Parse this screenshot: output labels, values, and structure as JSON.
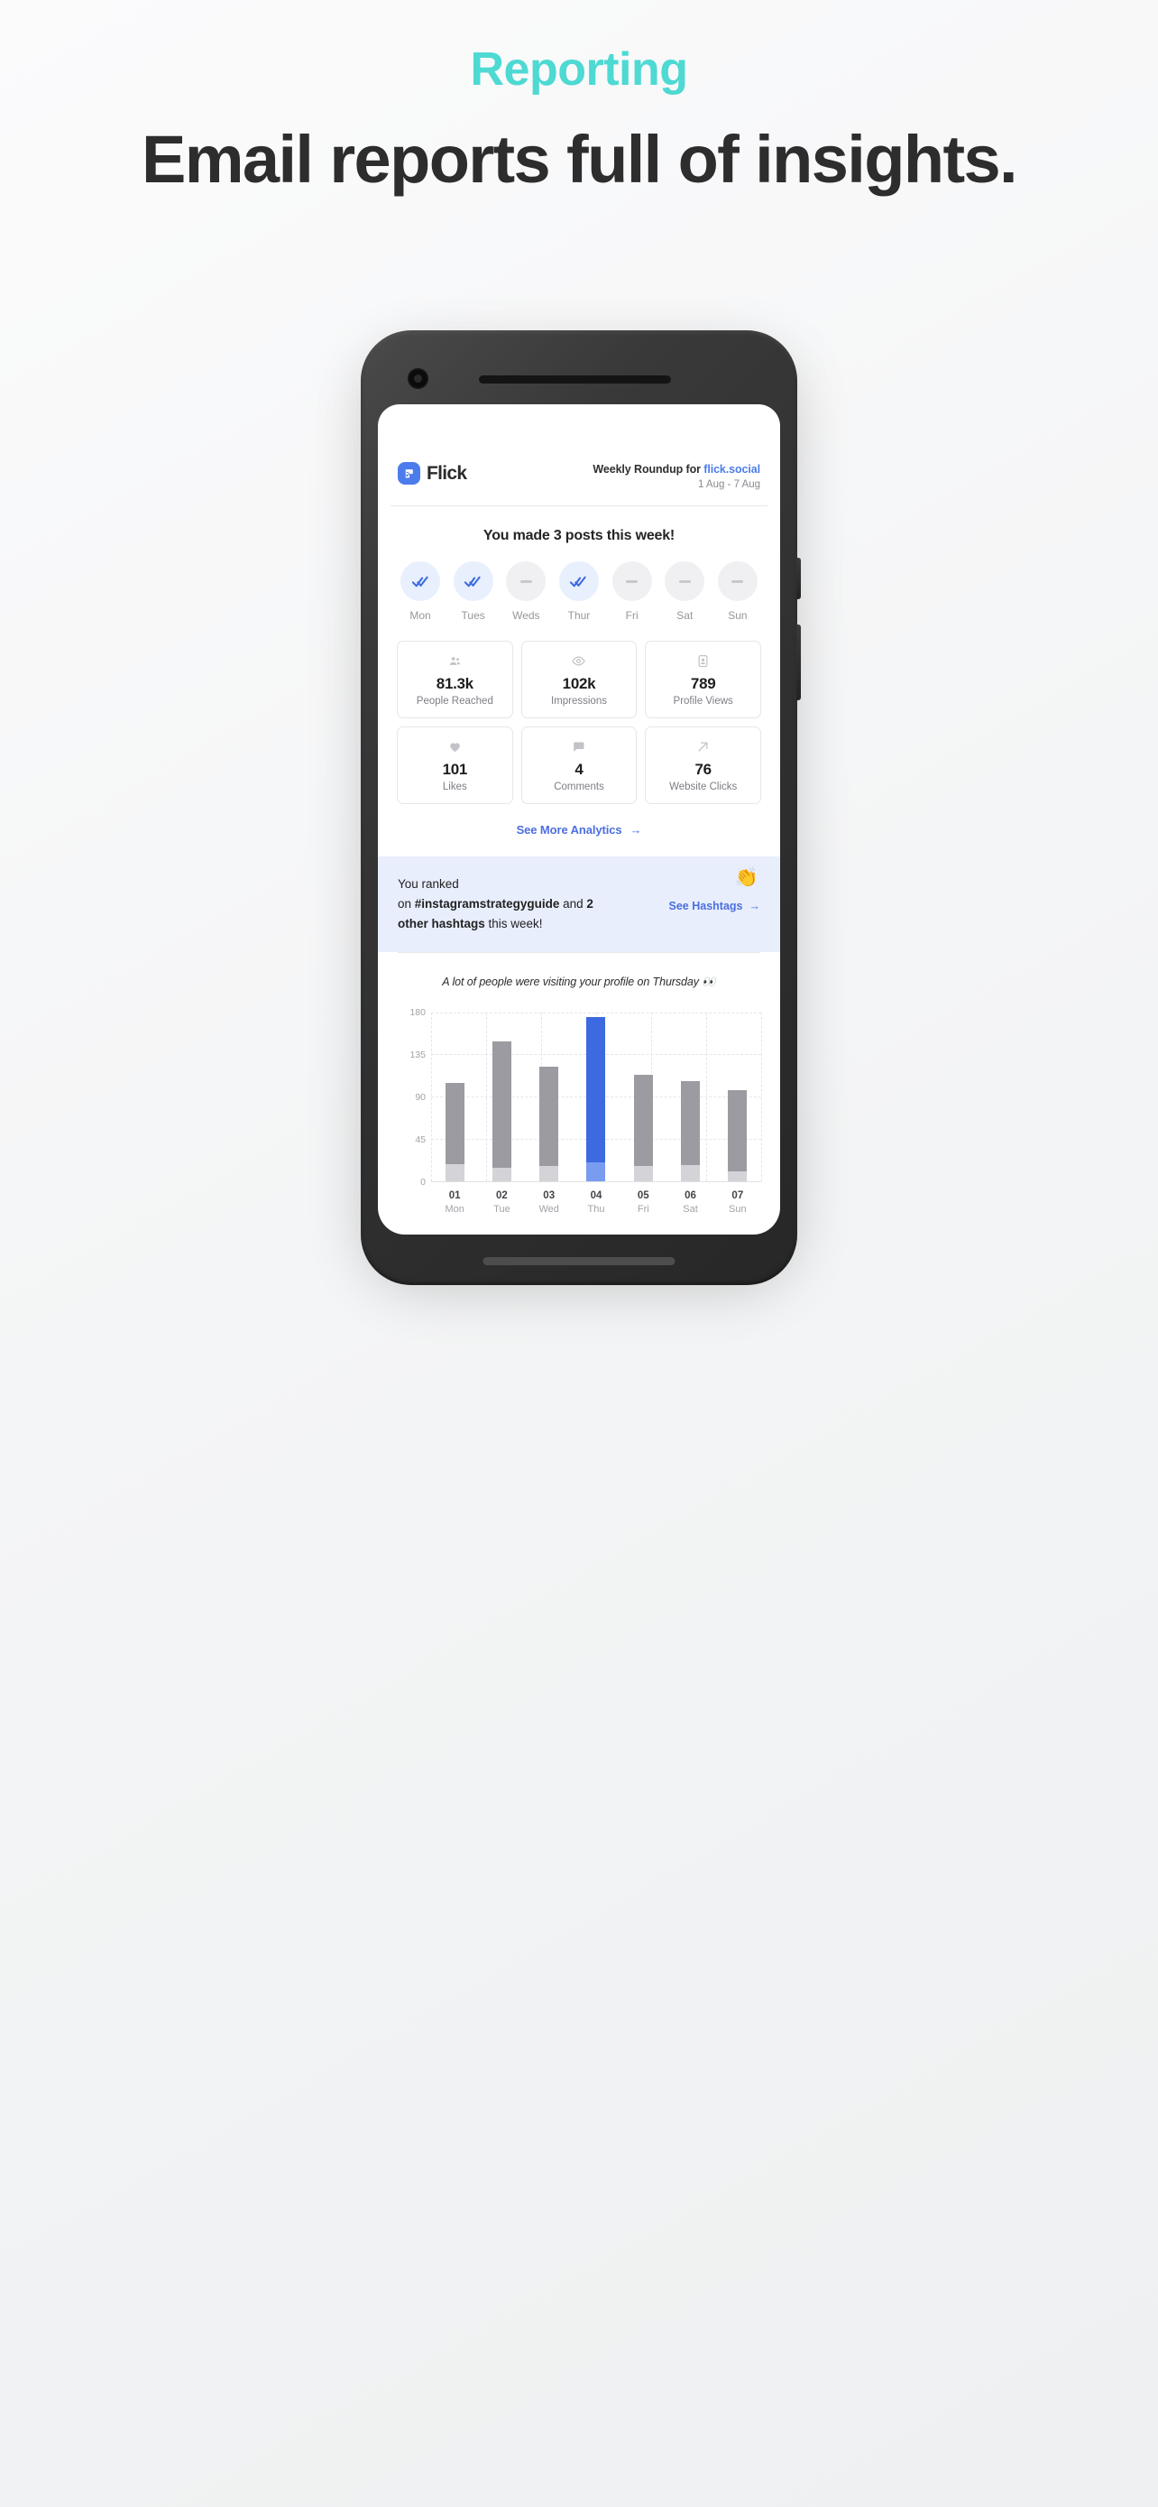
{
  "hero": {
    "eyebrow": "Reporting",
    "title": "Email reports full of insights."
  },
  "email": {
    "brand_name": "Flick",
    "brand_icon": "flick-logo-icon",
    "roundup_prefix": "Weekly Roundup for ",
    "roundup_handle": "flick.social",
    "date_range": "1 Aug - 7 Aug",
    "posts_title": "You made 3 posts this week!",
    "days": [
      {
        "label": "Mon",
        "posted": true,
        "icon": "double-check-icon"
      },
      {
        "label": "Tues",
        "posted": true,
        "icon": "double-check-icon"
      },
      {
        "label": "Weds",
        "posted": false,
        "icon": "dash-icon"
      },
      {
        "label": "Thur",
        "posted": true,
        "icon": "double-check-icon"
      },
      {
        "label": "Fri",
        "posted": false,
        "icon": "dash-icon"
      },
      {
        "label": "Sat",
        "posted": false,
        "icon": "dash-icon"
      },
      {
        "label": "Sun",
        "posted": false,
        "icon": "dash-icon"
      }
    ],
    "stats": [
      {
        "value": "81.3k",
        "label": "People Reached",
        "icon": "people-icon"
      },
      {
        "value": "102k",
        "label": "Impressions",
        "icon": "eye-icon"
      },
      {
        "value": "789",
        "label": "Profile Views",
        "icon": "contact-card-icon"
      },
      {
        "value": "101",
        "label": "Likes",
        "icon": "heart-icon"
      },
      {
        "value": "4",
        "label": "Comments",
        "icon": "comment-icon"
      },
      {
        "value": "76",
        "label": "Website Clicks",
        "icon": "arrow-up-right-icon"
      }
    ],
    "see_more_label": "See More Analytics",
    "see_more_arrow": "→",
    "hashtag_panel": {
      "line1": "You ranked",
      "line2_prefix": "on ",
      "hashtag": "#instagramstrategyguide",
      "line2_mid": " and ",
      "count": "2",
      "line3_bold": "other hashtags",
      "line3_rest": " this week!",
      "link_label": "See Hashtags",
      "link_arrow": "→",
      "emoji": "👏"
    },
    "chart_caption": "A lot of people were visiting your profile on Thursday 👀",
    "accent_blue": "#4c7ceb",
    "accent_teal": "#4ed9d3",
    "bar_grey": "#9b9ba1",
    "bar_base_grey": "#d3d3d8"
  },
  "chart_data": {
    "type": "bar",
    "title": "A lot of people were visiting your profile on Thursday 👀",
    "categories": [
      "01",
      "02",
      "03",
      "04",
      "05",
      "06",
      "07"
    ],
    "category_days": [
      "Mon",
      "Tue",
      "Wed",
      "Thu",
      "Fri",
      "Sat",
      "Sun"
    ],
    "series": [
      {
        "name": "Profile views",
        "values": [
          105,
          149,
          122,
          175,
          113,
          106,
          97
        ]
      },
      {
        "name": "Base segment",
        "values": [
          18,
          14,
          16,
          20,
          16,
          17,
          10
        ]
      }
    ],
    "values": [
      105,
      149,
      122,
      175,
      113,
      106,
      97
    ],
    "highlight_index": 3,
    "highlight_color": "#3d6ae0",
    "bar_color": "#9b9ba1",
    "base_color": "#d3d3d8",
    "ylim": [
      0,
      180
    ],
    "yticks": [
      0,
      45,
      90,
      135,
      180
    ],
    "xlabel": "",
    "ylabel": "",
    "grid": true,
    "legend": false
  }
}
